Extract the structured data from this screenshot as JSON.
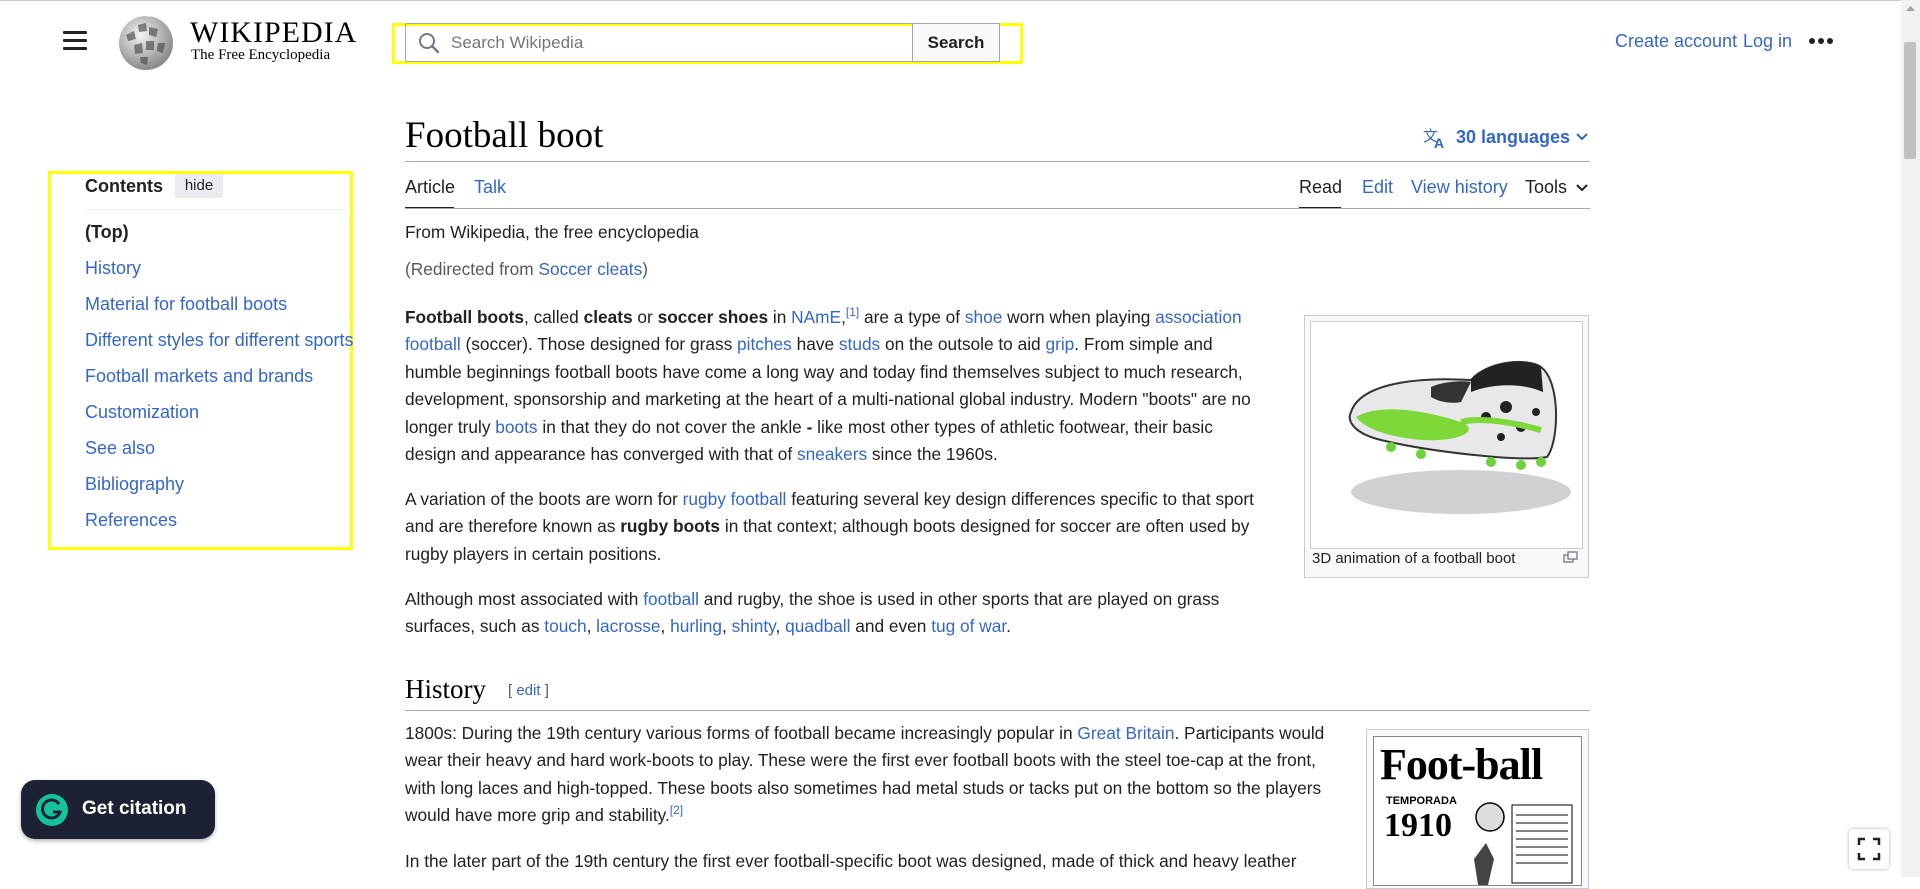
{
  "header": {
    "logo_wordmark": "WIKIPEDIA",
    "logo_tagline": "The Free Encyclopedia",
    "search_placeholder": "Search Wikipedia",
    "search_button": "Search",
    "create_account": "Create account",
    "log_in": "Log in"
  },
  "toc": {
    "title": "Contents",
    "hide_label": "hide",
    "items": [
      "(Top)",
      "History",
      "Material for football boots",
      "Different styles for different sports",
      "Football markets and brands",
      "Customization",
      "See also",
      "Bibliography",
      "References"
    ]
  },
  "article": {
    "title": "Football boot",
    "languages": "30 languages",
    "tabs": {
      "article": "Article",
      "talk": "Talk",
      "read": "Read",
      "edit": "Edit",
      "view_history": "View history",
      "tools": "Tools"
    },
    "from": "From Wikipedia, the free encyclopedia",
    "redirect_prefix": "(Redirected from ",
    "redirect_link": "Soccer cleats",
    "redirect_suffix": ")",
    "p1": [
      {
        "t": "Football boots",
        "b": true
      },
      {
        "t": ", called "
      },
      {
        "t": "cleats",
        "b": true
      },
      {
        "t": " or "
      },
      {
        "t": "soccer shoes",
        "b": true
      },
      {
        "t": " in "
      },
      {
        "t": "NAmE",
        "l": true
      },
      {
        "t": ",",
        "l": false
      },
      {
        "t": "[1]",
        "s": true
      },
      {
        "t": " are a type of "
      },
      {
        "t": "shoe",
        "l": true
      },
      {
        "t": " worn when playing "
      },
      {
        "t": "association football",
        "l": true
      },
      {
        "t": " (soccer). Those designed for grass "
      },
      {
        "t": "pitches",
        "l": true
      },
      {
        "t": " have "
      },
      {
        "t": "studs",
        "l": true
      },
      {
        "t": " on the outsole to aid "
      },
      {
        "t": "grip",
        "l": true
      },
      {
        "t": ". From simple and humble beginnings football boots have come a long way and today find themselves subject to much research, development, sponsorship and marketing at the heart of a multi-national global industry. Modern \"boots\" are no longer truly "
      },
      {
        "t": "boots",
        "l": true
      },
      {
        "t": " in that they do not cover the ankle "
      },
      {
        "t": "-",
        "b": true
      },
      {
        "t": " like most other types of athletic footwear, their basic design and appearance has converged with that of "
      },
      {
        "t": "sneakers",
        "l": true
      },
      {
        "t": " since the 1960s."
      }
    ],
    "p2": [
      {
        "t": "A variation of the boots are worn for "
      },
      {
        "t": "rugby football",
        "l": true
      },
      {
        "t": " featuring several key design differences specific to that sport and are therefore known as "
      },
      {
        "t": "rugby boots",
        "b": true
      },
      {
        "t": " in that context; although boots designed for soccer are often used by rugby players in certain positions."
      }
    ],
    "p3": [
      {
        "t": "Although most associated with "
      },
      {
        "t": "football",
        "l": true
      },
      {
        "t": " and rugby, the shoe is used in other sports that are played on grass surfaces, such as "
      },
      {
        "t": "touch",
        "l": true
      },
      {
        "t": ", "
      },
      {
        "t": "lacrosse",
        "l": true
      },
      {
        "t": ", "
      },
      {
        "t": "hurling",
        "l": true
      },
      {
        "t": ", "
      },
      {
        "t": "shinty",
        "l": true
      },
      {
        "t": ", "
      },
      {
        "t": "quadball",
        "l": true
      },
      {
        "t": " and even "
      },
      {
        "t": "tug of war",
        "l": true
      },
      {
        "t": "."
      }
    ],
    "infobox_caption": "3D animation of a football boot",
    "history_heading": "History",
    "history_edit": "edit",
    "p4": [
      {
        "t": "1800s: During the 19th century various forms of football became increasingly popular in "
      },
      {
        "t": "Great Britain",
        "l": true
      },
      {
        "t": ". Participants would wear their heavy and hard work-boots to play. These were the first ever football boots with the steel toe-cap at the front, with long laces and high-topped. These boots also sometimes had metal studs or tacks put on the bottom so the players would have more grip and stability."
      },
      {
        "t": "[2]",
        "s": true
      }
    ],
    "p5": [
      {
        "t": "In the later part of the 19th century the first ever football-specific boot was designed, made of thick and heavy leather"
      }
    ],
    "poster_title": "Foot-ball",
    "poster_temporada": "TEMPORADA",
    "poster_year": "1910"
  },
  "widgets": {
    "citation_label": "Get citation"
  },
  "colors": {
    "link": "#3366cc",
    "highlight": "#ffff00",
    "citation_bg": "#1c2134",
    "citation_logo": "#15c39a"
  }
}
